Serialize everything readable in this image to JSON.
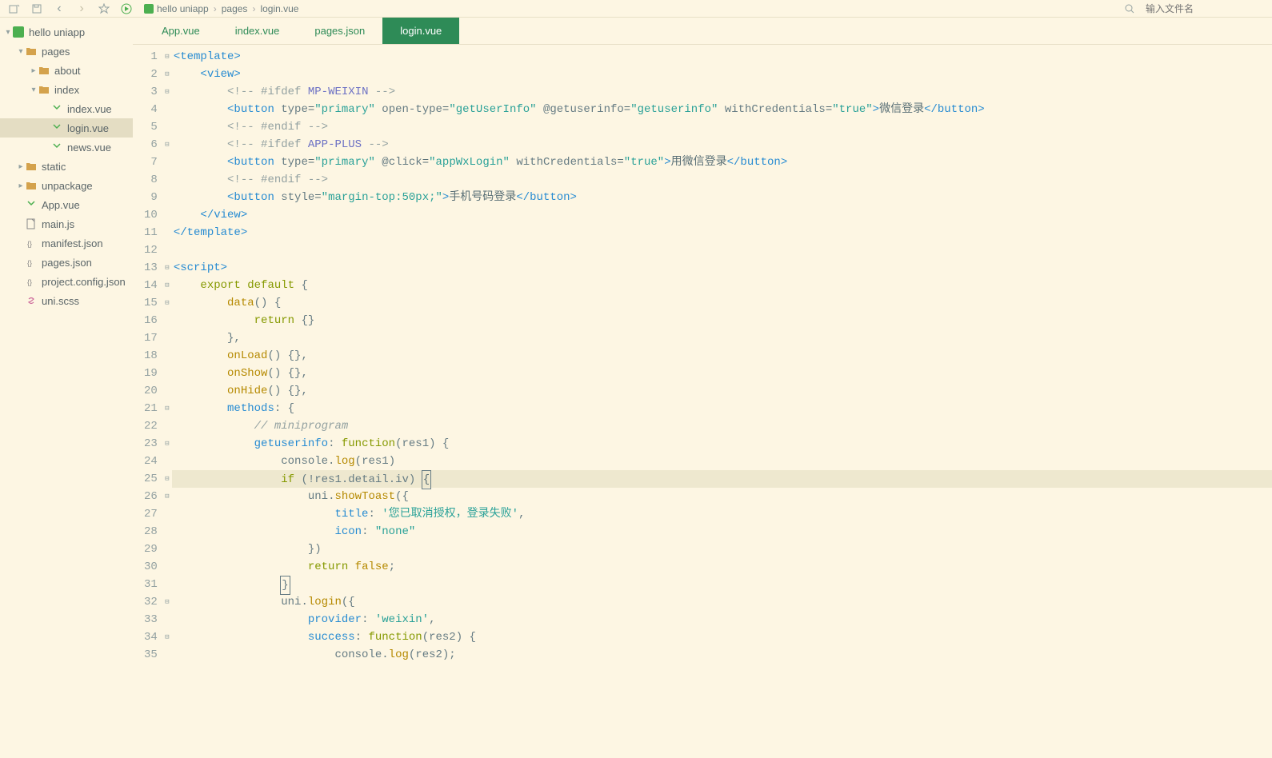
{
  "breadcrumb": {
    "project": "hello uniapp",
    "folder": "pages",
    "file": "login.vue"
  },
  "search": {
    "placeholder": "输入文件名"
  },
  "sidebar": {
    "root": "hello uniapp",
    "items": [
      {
        "label": "pages",
        "type": "folder",
        "depth": 1,
        "expanded": true
      },
      {
        "label": "about",
        "type": "folder",
        "depth": 2,
        "expanded": false
      },
      {
        "label": "index",
        "type": "folder",
        "depth": 2,
        "expanded": true
      },
      {
        "label": "index.vue",
        "type": "vue",
        "depth": 3
      },
      {
        "label": "login.vue",
        "type": "vue",
        "depth": 3,
        "selected": true
      },
      {
        "label": "news.vue",
        "type": "vue",
        "depth": 3
      },
      {
        "label": "static",
        "type": "folder",
        "depth": 1,
        "expanded": false
      },
      {
        "label": "unpackage",
        "type": "folder",
        "depth": 1,
        "expanded": false
      },
      {
        "label": "App.vue",
        "type": "vue",
        "depth": 1
      },
      {
        "label": "main.js",
        "type": "js",
        "depth": 1
      },
      {
        "label": "manifest.json",
        "type": "json",
        "depth": 1
      },
      {
        "label": "pages.json",
        "type": "json",
        "depth": 1
      },
      {
        "label": "project.config.json",
        "type": "json",
        "depth": 1
      },
      {
        "label": "uni.scss",
        "type": "scss",
        "depth": 1
      }
    ]
  },
  "tabs": [
    {
      "label": "App.vue",
      "active": false
    },
    {
      "label": "index.vue",
      "active": false
    },
    {
      "label": "pages.json",
      "active": false
    },
    {
      "label": "login.vue",
      "active": true
    }
  ],
  "code": {
    "first_line": 1,
    "last_line": 35,
    "highlighted_line": 25,
    "cursor_line": 25,
    "strings": {
      "primary": "\"primary\"",
      "getUserInfo": "\"getUserInfo\"",
      "getuserinfo": "\"getuserinfo\"",
      "true": "\"true\"",
      "appWxLogin": "\"appWxLogin\"",
      "margin": "\"margin-top:50px;\"",
      "toast_title": "'您已取消授权，登录失败'",
      "none": "\"none\"",
      "weixin": "'weixin'",
      "wechat_login": "微信登录",
      "use_wechat": "用微信登录",
      "phone_login": "手机号码登录",
      "mp_weixin": "MP-WEIXIN",
      "app_plus": "APP-PLUS",
      "miniprogram": "// miniprogram"
    }
  }
}
